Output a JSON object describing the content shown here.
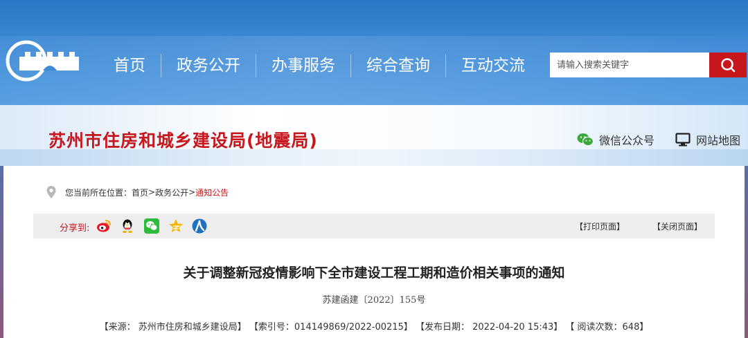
{
  "nav": {
    "items": [
      {
        "label": "首页"
      },
      {
        "label": "政务公开"
      },
      {
        "label": "办事服务"
      },
      {
        "label": "综合查询"
      },
      {
        "label": "互动交流"
      }
    ]
  },
  "search": {
    "placeholder": "请输入搜索关键字",
    "icon": "search-icon"
  },
  "site": {
    "title": "苏州市住房和城乡建设局(地震局)"
  },
  "quick_links": {
    "wechat": "微信公众号",
    "sitemap": "网站地图"
  },
  "breadcrumb": {
    "prefix": "您当前所在位置：",
    "home": "首页",
    "sep1": ">",
    "section": "政务公开",
    "sep2": ">",
    "current": "通知公告"
  },
  "share": {
    "label": "分享到:",
    "targets": [
      "weibo-icon",
      "qq-icon",
      "wechat-icon",
      "qzone-icon",
      "renren-icon"
    ]
  },
  "tools": {
    "print": "【打印页面】",
    "close": "【关闭页面】"
  },
  "article": {
    "title": "关于调整新冠疫情影响下全市建设工程工期和造价相关事项的通知",
    "doc_number": "苏建函建〔2022〕155号",
    "meta": "【来源： 苏州市住房和城乡建设局】 【索引号：014149869/2022-00215】 【发布日期： 2022-04-20 15:43】 【 阅读次数：648】"
  },
  "colors": {
    "brand_red": "#c8161d",
    "header_blue": "#3e8ad6"
  }
}
